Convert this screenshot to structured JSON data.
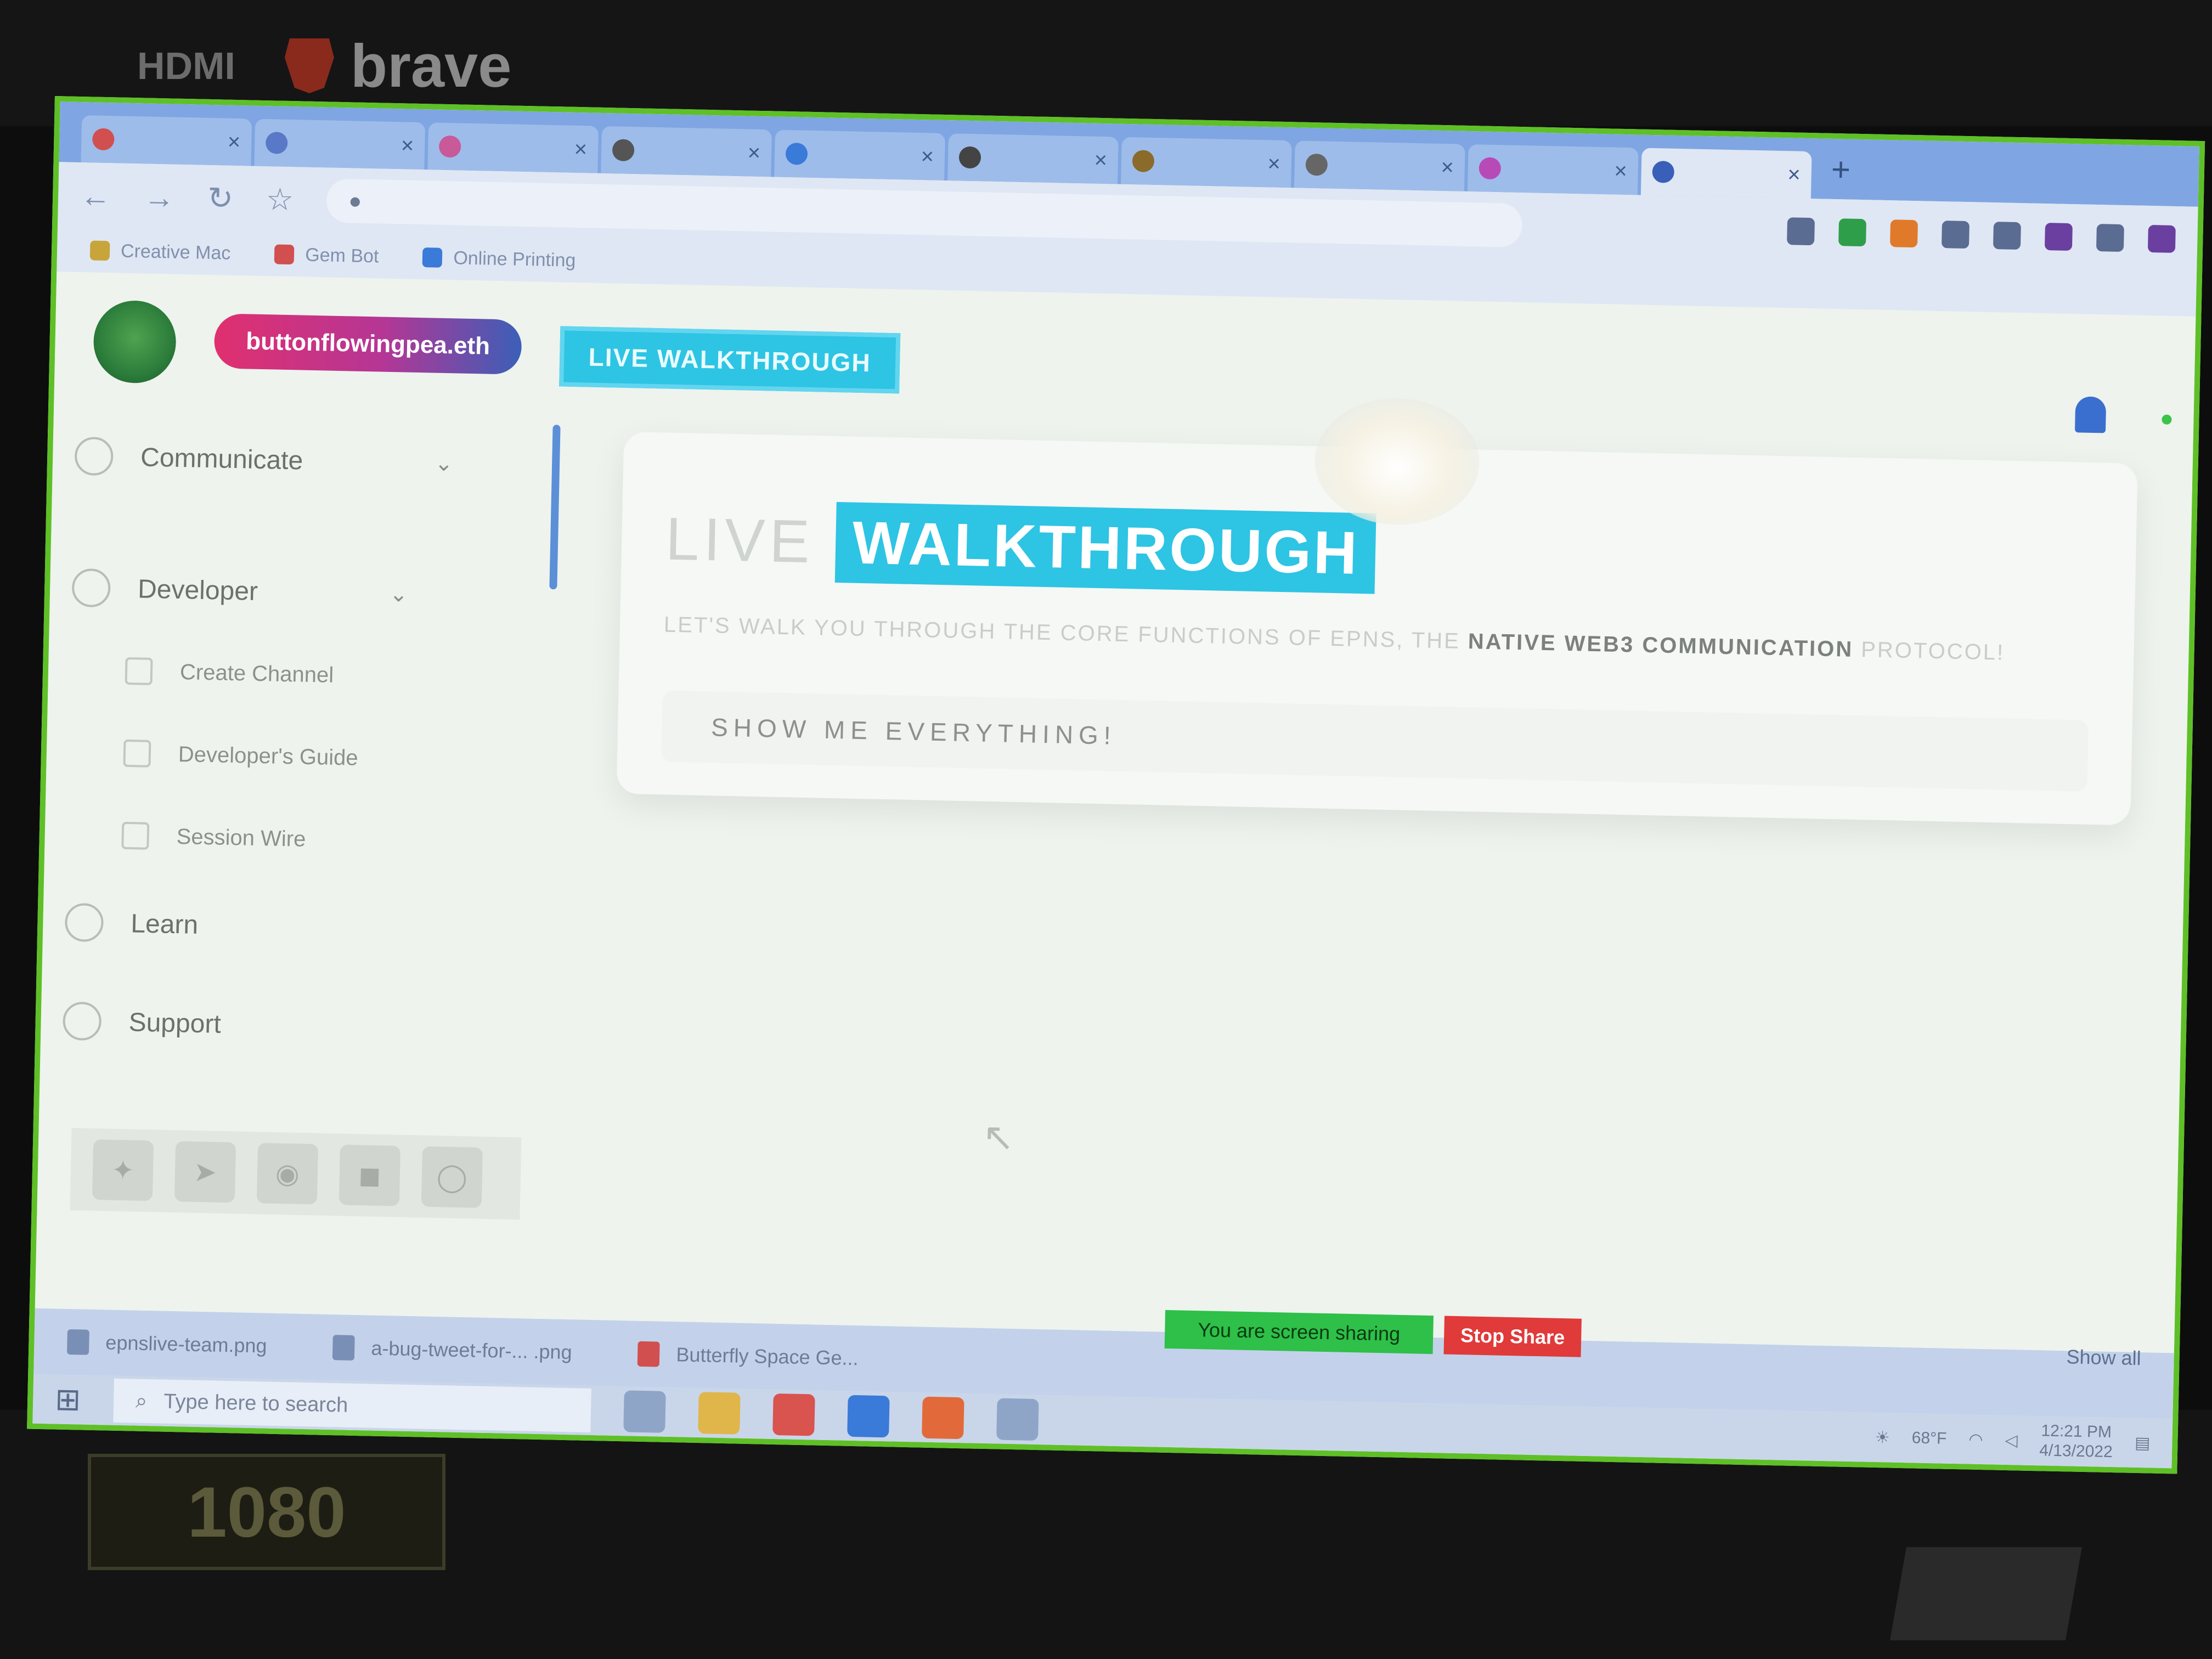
{
  "bezel": {
    "stickers": [
      "HDMI"
    ],
    "brand": "brave"
  },
  "browser": {
    "active_tab_title": "",
    "tab_count": 11,
    "url": "",
    "bookmarks": [
      "Creative Mac",
      "Gem Bot",
      "Online Printing"
    ]
  },
  "page": {
    "domain_pill": "buttonflowingpea.eth",
    "header_button": "LIVE WALKTHROUGH",
    "sidebar": {
      "items": [
        {
          "label": "Communicate"
        },
        {
          "label": "Developer"
        },
        {
          "label": "Learn"
        },
        {
          "label": "Support"
        }
      ],
      "sub_items": [
        {
          "label": "Create Channel"
        },
        {
          "label": "Developer's Guide"
        },
        {
          "label": "Session Wire"
        }
      ],
      "social_count": 5
    },
    "hero": {
      "title_light": "LIVE",
      "title_highlight": "WALKTHROUGH",
      "subtitle_prefix": "LET'S WALK YOU THROUGH THE CORE FUNCTIONS OF EPNS, THE",
      "subtitle_bold": "NATIVE WEB3 COMMUNICATION",
      "subtitle_suffix": "PROTOCOL!",
      "button_label": "SHOW ME EVERYTHING!"
    }
  },
  "downloads": {
    "items": [
      "epnslive-team.png",
      "a-bug-tweet-for-... .png",
      "Butterfly Space Ge..."
    ],
    "show_all": "Show all"
  },
  "screen_share": {
    "message": "You are screen sharing",
    "stop_label": "Stop Share"
  },
  "taskbar": {
    "search_placeholder": "Type here to search",
    "weather": "68°F",
    "time": "12:21 PM",
    "date": "4/13/2022"
  },
  "colors": {
    "accent": "#2ec4e4",
    "pill_start": "#e0306f",
    "pill_end": "#3b5fb8",
    "screen_border": "#5ec026"
  }
}
